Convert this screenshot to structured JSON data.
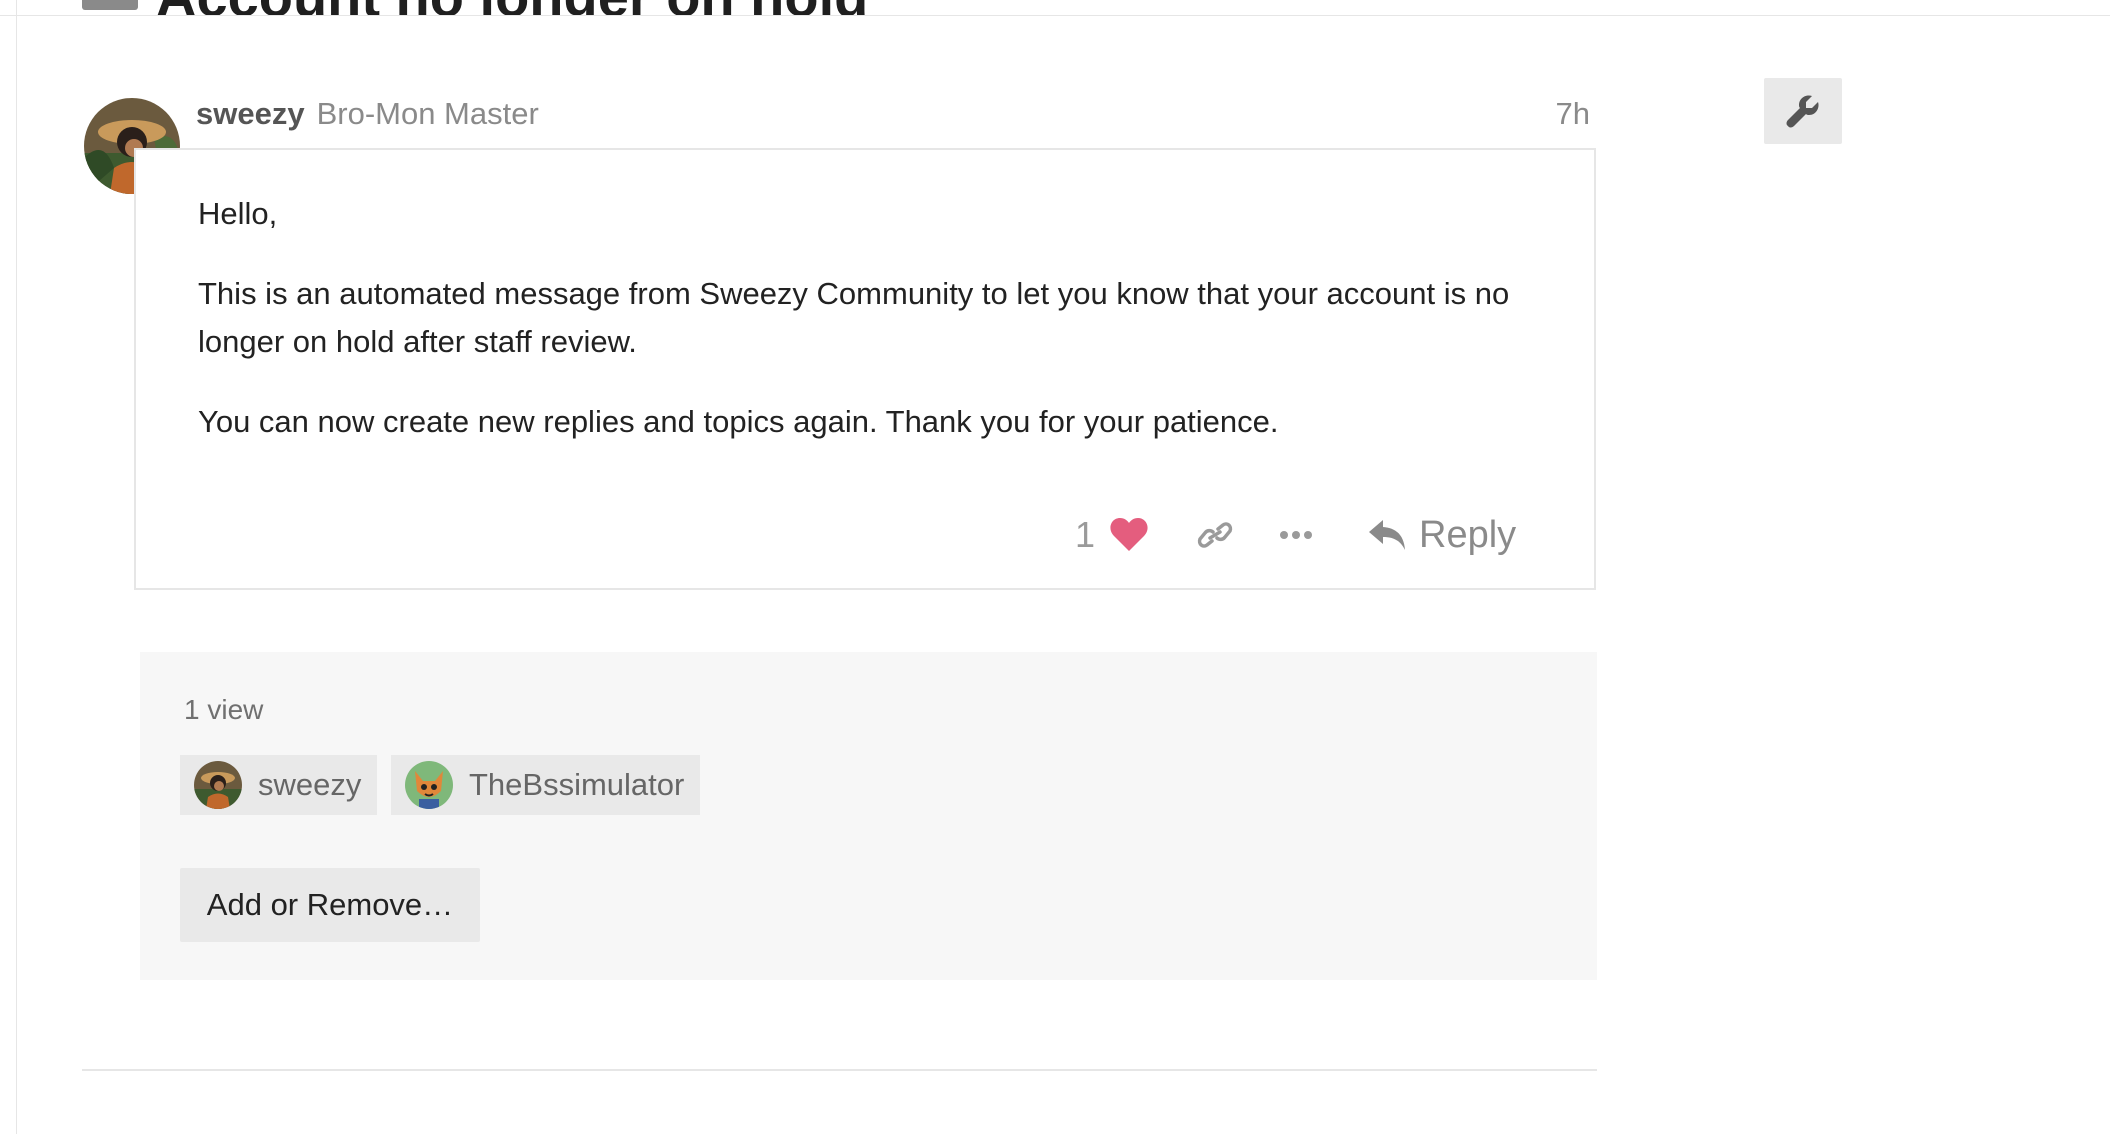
{
  "topic": {
    "title": "Account no longer on hold"
  },
  "post": {
    "username": "sweezy",
    "user_title": "Bro-Mon Master",
    "date": "7h",
    "paragraphs": [
      "Hello,",
      "This is an automated message from Sweezy Community to let you know that your account is no longer on hold after staff review.",
      "You can now create new replies and topics again. Thank you for your patience."
    ],
    "actions": {
      "like_count": "1",
      "reply_label": "Reply"
    }
  },
  "viewers": {
    "views_label": "1 view",
    "users": [
      {
        "name": "sweezy"
      },
      {
        "name": "TheBssimulator"
      }
    ],
    "add_remove_label": "Add or Remove…"
  },
  "icons": {
    "like": "heart-icon",
    "link": "link-icon",
    "more": "ellipsis-icon",
    "reply": "reply-arrow-icon",
    "admin": "wrench-icon",
    "flair": "skull-crossbones-icon"
  },
  "colors": {
    "like_heart": "#e45d7e",
    "muted_text": "#8a8a8a",
    "panel_bg": "#f7f7f7",
    "chip_bg": "#e9e9e9"
  }
}
